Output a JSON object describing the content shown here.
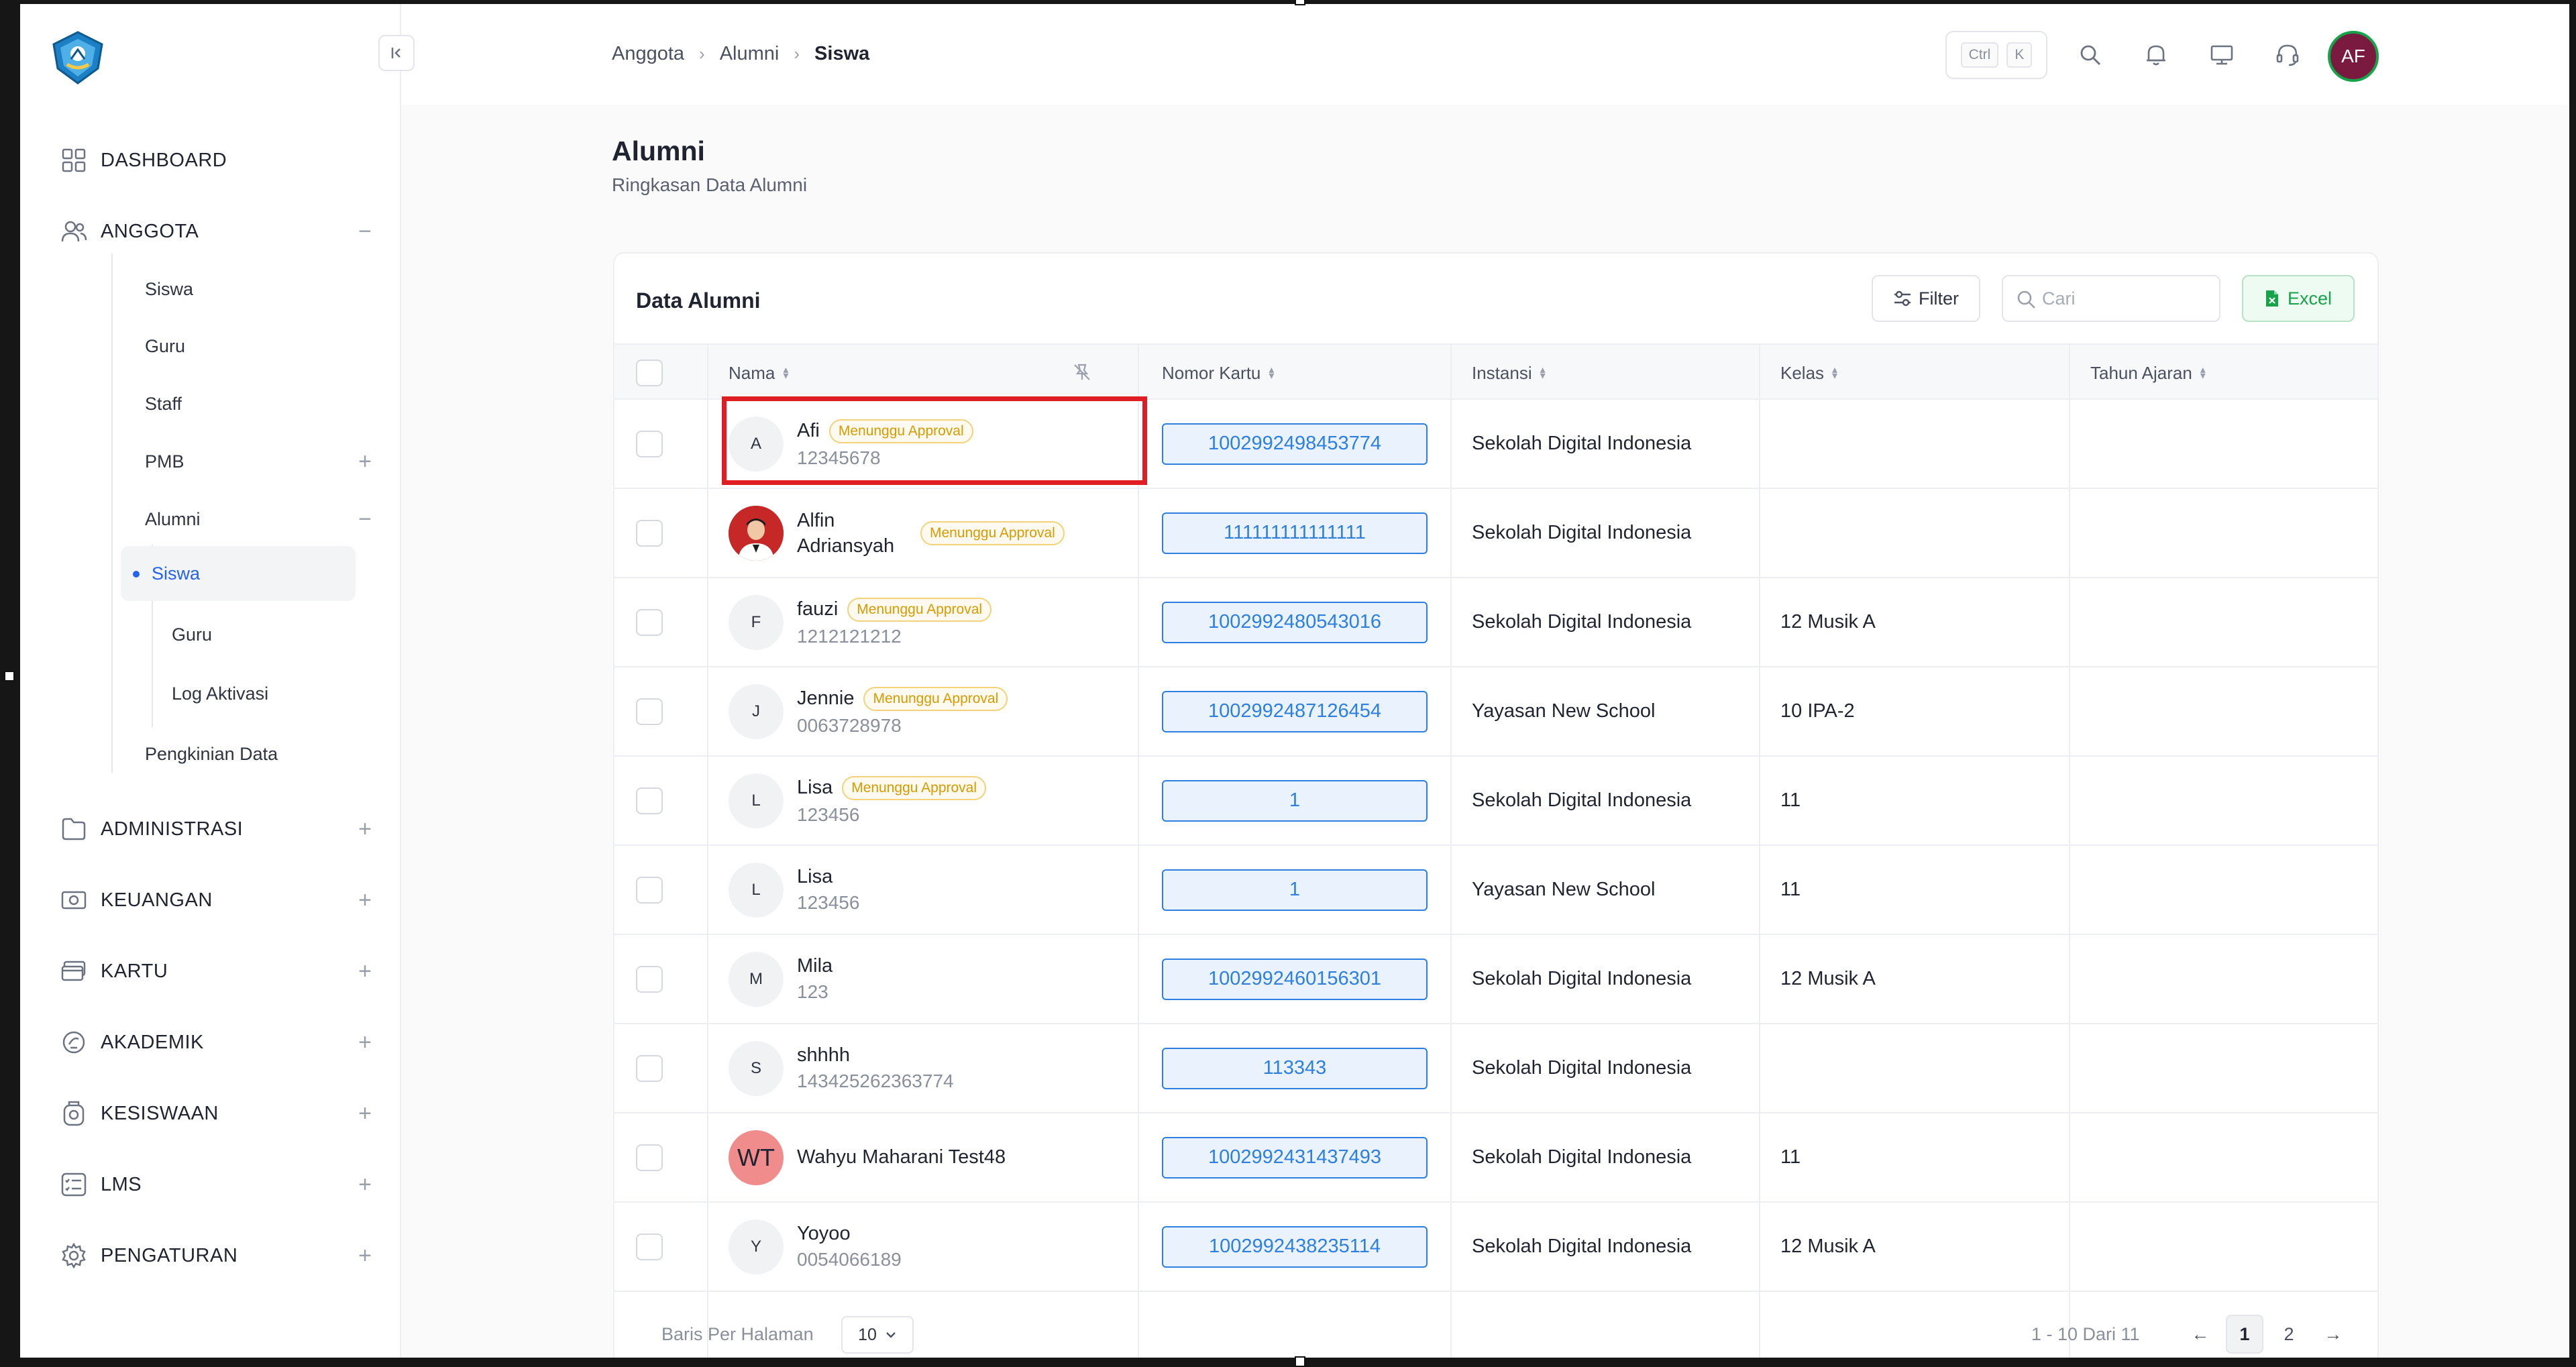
{
  "breadcrumb": [
    "Anggota",
    "Alumni",
    "Siswa"
  ],
  "shortcut": {
    "ctrl": "Ctrl",
    "key": "K"
  },
  "user": {
    "initials": "AF"
  },
  "page": {
    "title": "Alumni",
    "subtitle": "Ringkasan Data Alumni"
  },
  "sidebar": {
    "nav": [
      {
        "label": "DASHBOARD",
        "icon": "dashboard-icon",
        "toggle": ""
      },
      {
        "label": "ANGGOTA",
        "icon": "users-icon",
        "toggle": "−"
      },
      {
        "label": "ADMINISTRASI",
        "icon": "folder-icon",
        "toggle": "+"
      },
      {
        "label": "KEUANGAN",
        "icon": "money-icon",
        "toggle": "+"
      },
      {
        "label": "KARTU",
        "icon": "card-icon",
        "toggle": "+"
      },
      {
        "label": "AKADEMIK",
        "icon": "academic-icon",
        "toggle": "+"
      },
      {
        "label": "KESISWAAN",
        "icon": "student-affairs-icon",
        "toggle": "+"
      },
      {
        "label": "LMS",
        "icon": "lms-icon",
        "toggle": "+"
      },
      {
        "label": "PENGATURAN",
        "icon": "settings-icon",
        "toggle": "+"
      }
    ],
    "anggota_items": [
      "Siswa",
      "Guru",
      "Staff",
      "PMB",
      "Alumni",
      "Pengkinian Data"
    ],
    "pmb_toggle": "+",
    "alumni_toggle": "−",
    "alumni_items": [
      "Siswa",
      "Guru",
      "Log Aktivasi"
    ]
  },
  "table": {
    "title": "Data Alumni",
    "filter_label": "Filter",
    "search_placeholder": "Cari",
    "excel_label": "Excel",
    "columns": [
      "Nama",
      "Nomor Kartu",
      "Instansi",
      "Kelas",
      "Tahun Ajaran"
    ],
    "badge_label": "Menunggu Approval",
    "rows": [
      {
        "initial": "A",
        "name": "Afi",
        "id": "12345678",
        "badge": true,
        "card": "1002992498453774",
        "instansi": "Sekolah Digital Indonesia",
        "kelas": "",
        "tahun": ""
      },
      {
        "initial": "",
        "name": "Alfin Adriansyah",
        "id": "",
        "badge": true,
        "card": "111111111111111",
        "instansi": "Sekolah Digital Indonesia",
        "kelas": "",
        "tahun": "",
        "photo": true
      },
      {
        "initial": "F",
        "name": "fauzi",
        "id": "1212121212",
        "badge": true,
        "card": "1002992480543016",
        "instansi": "Sekolah Digital Indonesia",
        "kelas": "12 Musik A",
        "tahun": ""
      },
      {
        "initial": "J",
        "name": "Jennie",
        "id": "0063728978",
        "badge": true,
        "card": "1002992487126454",
        "instansi": "Yayasan New School",
        "kelas": "10 IPA-2",
        "tahun": ""
      },
      {
        "initial": "L",
        "name": "Lisa",
        "id": "123456",
        "badge": true,
        "card": "1",
        "instansi": "Sekolah Digital Indonesia",
        "kelas": "11",
        "tahun": ""
      },
      {
        "initial": "L",
        "name": "Lisa",
        "id": "123456",
        "badge": false,
        "card": "1",
        "instansi": "Yayasan New School",
        "kelas": "11",
        "tahun": ""
      },
      {
        "initial": "M",
        "name": "Mila",
        "id": "123",
        "badge": false,
        "card": "1002992460156301",
        "instansi": "Sekolah Digital Indonesia",
        "kelas": "12 Musik A",
        "tahun": ""
      },
      {
        "initial": "S",
        "name": "shhhh",
        "id": "143425262363774",
        "badge": false,
        "card": "113343",
        "instansi": "Sekolah Digital Indonesia",
        "kelas": "",
        "tahun": ""
      },
      {
        "initial": "WT",
        "name": "Wahyu Maharani Test48",
        "id": "",
        "badge": false,
        "card": "1002992431437493",
        "instansi": "Sekolah Digital Indonesia",
        "kelas": "11",
        "tahun": "",
        "pink": true
      },
      {
        "initial": "Y",
        "name": "Yoyoo",
        "id": "0054066189",
        "badge": false,
        "card": "1002992438235114",
        "instansi": "Sekolah Digital Indonesia",
        "kelas": "12 Musik A",
        "tahun": ""
      }
    ]
  },
  "pagination": {
    "rows_per_page_label": "Baris Per Halaman",
    "rows_per_page": "10",
    "range": "1 - 10 Dari 11",
    "prev": "←",
    "pages": [
      "1",
      "2"
    ],
    "next": "→",
    "current": "1"
  },
  "colors": {
    "accent": "#2563eb",
    "excel": "#16a34a",
    "badge": "#d79a00",
    "highlight": "#e11d24",
    "avatar": "#7a1a3f"
  }
}
